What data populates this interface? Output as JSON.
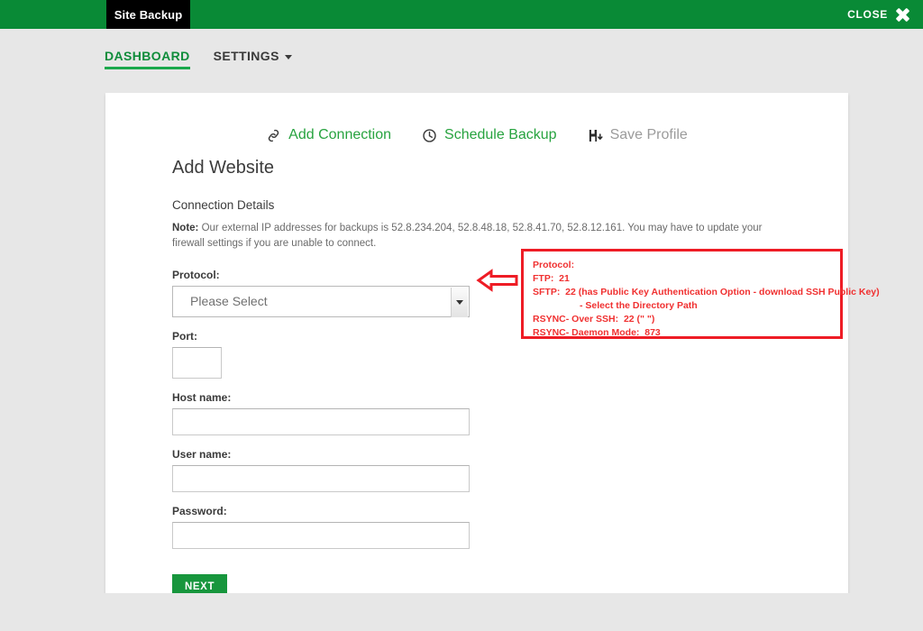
{
  "topbar": {
    "app_tab_label": "Site Backup",
    "close_label": "CLOSE",
    "close_icon": "close-x-icon",
    "bar_color": "#098a36",
    "tab_color": "#000000"
  },
  "nav": {
    "items": [
      {
        "label": "DASHBOARD",
        "active": true
      },
      {
        "label": "SETTINGS",
        "active": false,
        "has_caret": true
      }
    ],
    "active_color": "#0e8c3a",
    "underline_color": "#1aa84c"
  },
  "actions": [
    {
      "label": "Add Connection",
      "icon": "link-icon",
      "enabled": true,
      "color": "#27a33f"
    },
    {
      "label": "Schedule Backup",
      "icon": "clock-icon",
      "enabled": true,
      "color": "#27a33f"
    },
    {
      "label": "Save Profile",
      "icon": "save-icon",
      "enabled": false,
      "color": "#9b9b9b"
    }
  ],
  "main": {
    "page_title": "Add Website",
    "section_title": "Connection Details",
    "note_prefix": "Note:",
    "note_text": " Our external IP addresses for backups is 52.8.234.204, 52.8.48.18, 52.8.41.70, 52.8.12.161. You may have to update your firewall settings if you are unable to connect.",
    "fields": {
      "protocol": {
        "label": "Protocol:",
        "selected": "Please Select",
        "options": [
          "Please Select",
          "FTP",
          "SFTP",
          "RSYNC- Over SSH",
          "RSYNC- Daemon Mode"
        ]
      },
      "port": {
        "label": "Port:",
        "value": "",
        "placeholder": ""
      },
      "host_name": {
        "label": "Host name:",
        "value": "",
        "placeholder": ""
      },
      "user_name": {
        "label": "User name:",
        "value": "",
        "placeholder": ""
      },
      "password": {
        "label": "Password:",
        "value": "",
        "placeholder": ""
      }
    },
    "next_button_label": "NEXT"
  },
  "annotation": {
    "border_color": "#ee1c25",
    "text_color": "#f03030",
    "arrow_icon": "left-arrow-icon",
    "lines": [
      "Protocol:",
      "FTP:  21",
      "SFTP:  22 (has Public Key Authentication Option - download SSH Public Key)",
      "- Select the Directory Path",
      "RSYNC- Over SSH:  22 (\" \")",
      "RSYNC- Daemon Mode:  873"
    ]
  }
}
